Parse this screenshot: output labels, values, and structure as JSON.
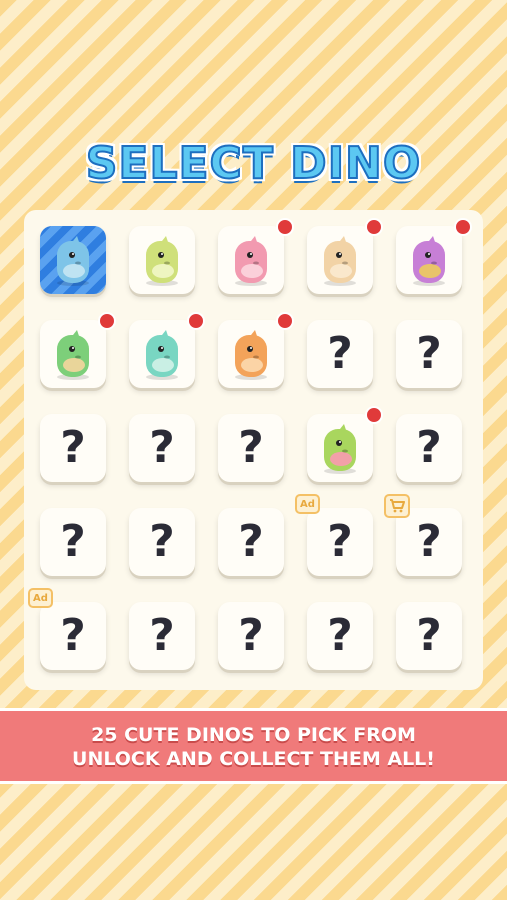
{
  "title": "SELECT DINO",
  "grid": [
    {
      "state": "selected",
      "dino": "blue-dino",
      "color": "#7ec4e8",
      "belly": "#bfe3f2"
    },
    {
      "state": "unlocked",
      "dino": "yellow-green-dino",
      "color": "#cfe07a",
      "belly": "#eef5c0"
    },
    {
      "state": "unlocked",
      "dino": "pink-dino",
      "color": "#f29ab0",
      "belly": "#fbd0da",
      "new": true
    },
    {
      "state": "unlocked",
      "dino": "beige-dino",
      "color": "#f2d3a6",
      "belly": "#fae8cc",
      "new": true
    },
    {
      "state": "unlocked",
      "dino": "purple-dino",
      "color": "#c77fd6",
      "belly": "#e9c46a",
      "new": true
    },
    {
      "state": "unlocked",
      "dino": "green-dino",
      "color": "#7dcf7a",
      "belly": "#e9d59a",
      "new": true
    },
    {
      "state": "unlocked",
      "dino": "teal-dino",
      "color": "#79d6c2",
      "belly": "#c9efe4",
      "new": true
    },
    {
      "state": "unlocked",
      "dino": "orange-dino",
      "color": "#f3a35a",
      "belly": "#fbd4a6",
      "new": true
    },
    {
      "state": "locked",
      "label": "?"
    },
    {
      "state": "locked",
      "label": "?"
    },
    {
      "state": "locked",
      "label": "?"
    },
    {
      "state": "locked",
      "label": "?"
    },
    {
      "state": "locked",
      "label": "?"
    },
    {
      "state": "unlocked",
      "dino": "lime-dino",
      "color": "#a9d65e",
      "belly": "#f2a0a8",
      "new": true
    },
    {
      "state": "locked",
      "label": "?"
    },
    {
      "state": "locked",
      "label": "?"
    },
    {
      "state": "locked",
      "label": "?"
    },
    {
      "state": "locked",
      "label": "?"
    },
    {
      "state": "locked",
      "label": "?",
      "ad": "Ad"
    },
    {
      "state": "locked",
      "label": "?",
      "shop": "cart-icon"
    },
    {
      "state": "locked",
      "label": "?",
      "ad": "Ad"
    },
    {
      "state": "locked",
      "label": "?"
    },
    {
      "state": "locked",
      "label": "?"
    },
    {
      "state": "locked",
      "label": "?"
    },
    {
      "state": "locked",
      "label": "?"
    }
  ],
  "banner": {
    "line1": "25 CUTE DINOS TO PICK FROM",
    "line2": "UNLOCK AND COLLECT THEM ALL!"
  },
  "colors": {
    "new_dot": "#e03a3a",
    "ad_badge": "#f4c065",
    "banner": "#f07a7a",
    "title": "#5cc8f2"
  }
}
